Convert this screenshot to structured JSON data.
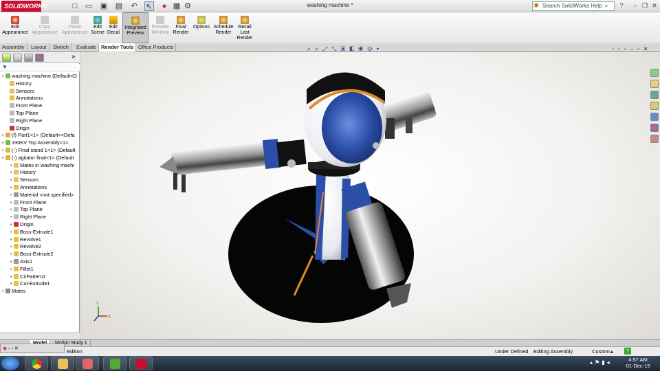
{
  "app": {
    "logo": "SOLIDWORKS",
    "doc_title": "washing machine *"
  },
  "search": {
    "placeholder": "Search SolidWorks Help"
  },
  "ribbon": {
    "buttons": [
      {
        "label": "Edit Appearance",
        "enabled": true
      },
      {
        "label": "Copy Appearance",
        "enabled": false
      },
      {
        "label": "Paste Appearance",
        "enabled": false
      },
      {
        "label": "Edit Scene",
        "enabled": true
      },
      {
        "label": "Edit Decal",
        "enabled": true
      },
      {
        "label": "Integrated Preview",
        "enabled": true,
        "active": true
      },
      {
        "label": "Preview Window",
        "enabled": false
      },
      {
        "label": "Final Render",
        "enabled": true
      },
      {
        "label": "Options",
        "enabled": true
      },
      {
        "label": "Schedule Render",
        "enabled": true
      },
      {
        "label": "Recall Last Render",
        "enabled": true
      }
    ]
  },
  "tabs": [
    "Assembly",
    "Layout",
    "Sketch",
    "Evaluate",
    "Render Tools",
    "Office Products"
  ],
  "active_tab": "Render Tools",
  "tree": [
    {
      "label": "washing machine  (Default<D",
      "indent": 0,
      "icon": "assembly-icon"
    },
    {
      "label": "History",
      "indent": 1,
      "icon": "folder-icon"
    },
    {
      "label": "Sensors",
      "indent": 1,
      "icon": "folder-icon"
    },
    {
      "label": "Annotations",
      "indent": 1,
      "icon": "annotations-icon"
    },
    {
      "label": "Front Plane",
      "indent": 1,
      "icon": "plane-icon"
    },
    {
      "label": "Top Plane",
      "indent": 1,
      "icon": "plane-icon"
    },
    {
      "label": "Right Plane",
      "indent": 1,
      "icon": "plane-icon"
    },
    {
      "label": "Origin",
      "indent": 1,
      "icon": "origin-icon"
    },
    {
      "label": "(f) Part1<1> (Default<<Defa",
      "indent": 0,
      "icon": "part-icon"
    },
    {
      "label": "330KV Top Assembly<1>",
      "indent": 0,
      "icon": "assembly-icon"
    },
    {
      "label": "(-) Final stand 1<1> (Default",
      "indent": 0,
      "icon": "part-icon"
    },
    {
      "label": "(-) agitator final<1> (Default",
      "indent": 0,
      "icon": "part-icon"
    },
    {
      "label": "Mates in washing machi",
      "indent": 2,
      "icon": "folder-icon"
    },
    {
      "label": "History",
      "indent": 2,
      "icon": "folder-icon"
    },
    {
      "label": "Sensors",
      "indent": 2,
      "icon": "folder-icon"
    },
    {
      "label": "Annotations",
      "indent": 2,
      "icon": "annotations-icon"
    },
    {
      "label": "Material <not specified>",
      "indent": 2,
      "icon": "material-icon"
    },
    {
      "label": "Front Plane",
      "indent": 2,
      "icon": "plane-icon"
    },
    {
      "label": "Top Plane",
      "indent": 2,
      "icon": "plane-icon"
    },
    {
      "label": "Right Plane",
      "indent": 2,
      "icon": "plane-icon"
    },
    {
      "label": "Origin",
      "indent": 2,
      "icon": "origin-icon"
    },
    {
      "label": "Boss-Extrude1",
      "indent": 2,
      "icon": "feature-icon"
    },
    {
      "label": "Revolve1",
      "indent": 2,
      "icon": "feature-icon"
    },
    {
      "label": "Revolve2",
      "indent": 2,
      "icon": "feature-icon"
    },
    {
      "label": "Boss-Extrude2",
      "indent": 2,
      "icon": "feature-icon"
    },
    {
      "label": "Axis1",
      "indent": 2,
      "icon": "axis-icon"
    },
    {
      "label": "Fillet1",
      "indent": 2,
      "icon": "feature-icon"
    },
    {
      "label": "CirPattern2",
      "indent": 2,
      "icon": "feature-icon"
    },
    {
      "label": "Cut-Extrude1",
      "indent": 2,
      "icon": "feature-icon"
    },
    {
      "label": "Mates",
      "indent": 0,
      "icon": "mates-icon"
    }
  ],
  "bottom_tabs": [
    "Model",
    "Motion Study 1"
  ],
  "status": {
    "left": "Edition",
    "units": "Under Defined",
    "mode": "Editing Assembly",
    "custom": "Custom"
  },
  "clock": {
    "time": "4:57 AM",
    "date": "01-Dec-15"
  },
  "colors": {
    "brand": "#c8102e",
    "robot_blue": "#2b4ea8",
    "accent_orange": "#e08a2a"
  }
}
